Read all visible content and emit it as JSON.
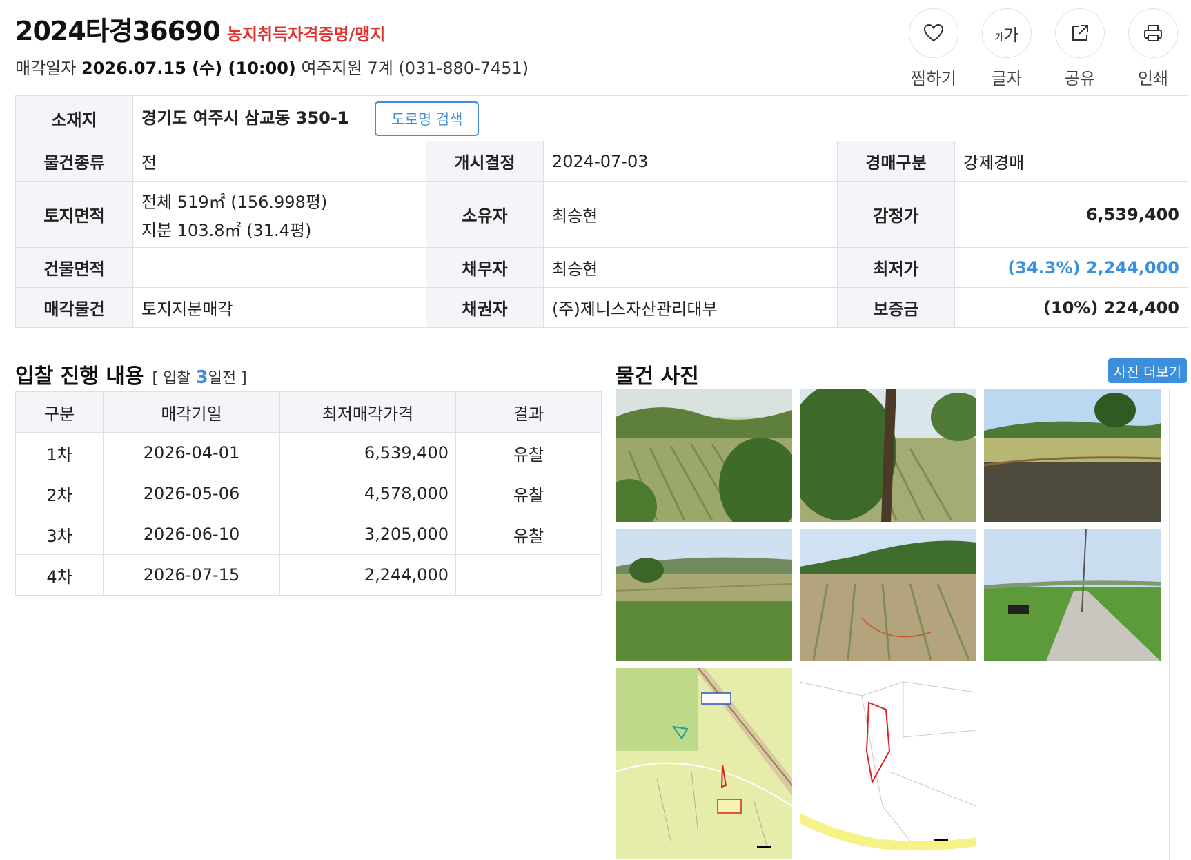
{
  "header": {
    "case_no": "2024타경36690",
    "farm_cert_link": "농지취득자격증명/맹지",
    "sale_label": "매각일자",
    "sale_date": "2026.07.15 (수) (10:00)",
    "court_info": "여주지원 7계 (031-880-7451)"
  },
  "actions": [
    {
      "label": "찜하기",
      "icon": "heart-icon"
    },
    {
      "label": "글자",
      "icon": "font-size-icon"
    },
    {
      "label": "공유",
      "icon": "share-icon"
    },
    {
      "label": "인쇄",
      "icon": "print-icon"
    }
  ],
  "font_icon": {
    "small": "가",
    "large": "가"
  },
  "info": {
    "location_label": "소재지",
    "location": "경기도 여주시 삼교동 350-1",
    "road_search": "도로명 검색",
    "type_label": "물건종류",
    "type": "전",
    "start_label": "개시결정",
    "start": "2024-07-03",
    "auction_type_label": "경매구분",
    "auction_type": "강제경매",
    "land_label": "토지면적",
    "land_total": "전체 519㎡ (156.998평)",
    "land_share": "지분 103.8㎡ (31.4평)",
    "owner_label": "소유자",
    "owner": "최승현",
    "appraisal_label": "감정가",
    "appraisal": "6,539,400",
    "building_label": "건물면적",
    "building": "",
    "debtor_label": "채무자",
    "debtor": "최승현",
    "min_label": "최저가",
    "min_price": "(34.3%) 2,244,000",
    "sale_item_label": "매각물건",
    "sale_item": "토지지분매각",
    "creditor_label": "채권자",
    "creditor": "(주)제니스자산관리대부",
    "deposit_label": "보증금",
    "deposit": "(10%) 224,400"
  },
  "bid": {
    "title": "입찰 진행 내용",
    "sub_prefix": "[ 입찰 ",
    "sub_days": "3",
    "sub_suffix": "일전 ]",
    "columns": [
      "구분",
      "매각기일",
      "최저매각가격",
      "결과"
    ],
    "rows": [
      {
        "round": "1차",
        "date": "2026-04-01",
        "price": "6,539,400",
        "result": "유찰"
      },
      {
        "round": "2차",
        "date": "2026-05-06",
        "price": "4,578,000",
        "result": "유찰"
      },
      {
        "round": "3차",
        "date": "2026-06-10",
        "price": "3,205,000",
        "result": "유찰"
      },
      {
        "round": "4차",
        "date": "2026-07-15",
        "price": "2,244,000",
        "result": ""
      }
    ]
  },
  "photos": {
    "title": "물건 사진",
    "more": "사진 더보기"
  },
  "colors": {
    "accent": "#3d8fdb",
    "alert": "#e03030",
    "header_bg": "#f3f5f8",
    "border": "#dcdfe4"
  }
}
